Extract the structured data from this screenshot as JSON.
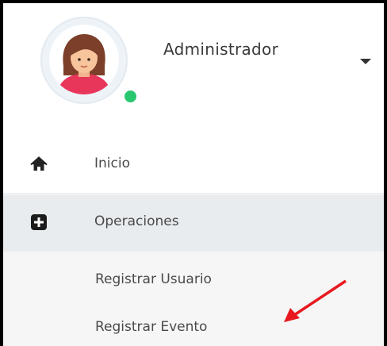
{
  "user": {
    "name": "Administrador",
    "status": "online",
    "status_color": "#28c76f"
  },
  "menu": {
    "items": [
      {
        "label": "Inicio",
        "icon": "home-icon"
      },
      {
        "label": "Operaciones",
        "icon": "plus-square-icon",
        "active": true
      }
    ],
    "submenu": [
      {
        "label": "Registrar Usuario"
      },
      {
        "label": "Registrar Evento"
      }
    ]
  },
  "annotation": {
    "type": "arrow",
    "color": "#e8191e",
    "points_to": "Registrar Evento"
  }
}
